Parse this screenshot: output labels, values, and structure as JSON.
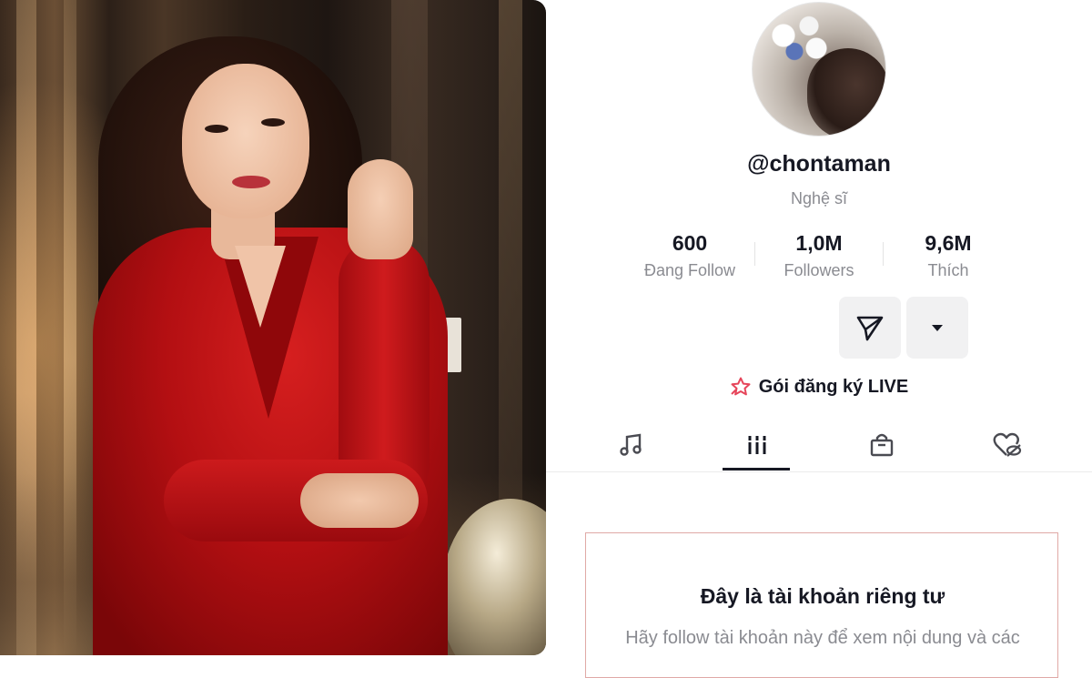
{
  "profile": {
    "username": "@chontaman",
    "subtitle": "Nghệ sĩ",
    "stats": [
      {
        "value": "600",
        "label": "Đang Follow"
      },
      {
        "value": "1,0M",
        "label": "Followers"
      },
      {
        "value": "9,6M",
        "label": "Thích"
      }
    ],
    "subscription_label": "Gói đăng ký LIVE",
    "tabs": [
      {
        "icon": "music-note-icon"
      },
      {
        "icon": "grid-icon",
        "active": true
      },
      {
        "icon": "shopping-bag-icon"
      },
      {
        "icon": "liked-hidden-icon"
      }
    ],
    "private_title": "Đây là tài khoản riêng tư",
    "private_desc": "Hãy follow tài khoản này để xem nội dung và các"
  },
  "colors": {
    "text_primary": "#161823",
    "text_secondary": "#8a8b91",
    "button_bg": "#f1f1f2",
    "live_star": "#e6455a",
    "private_border": "#e0a9a6"
  }
}
